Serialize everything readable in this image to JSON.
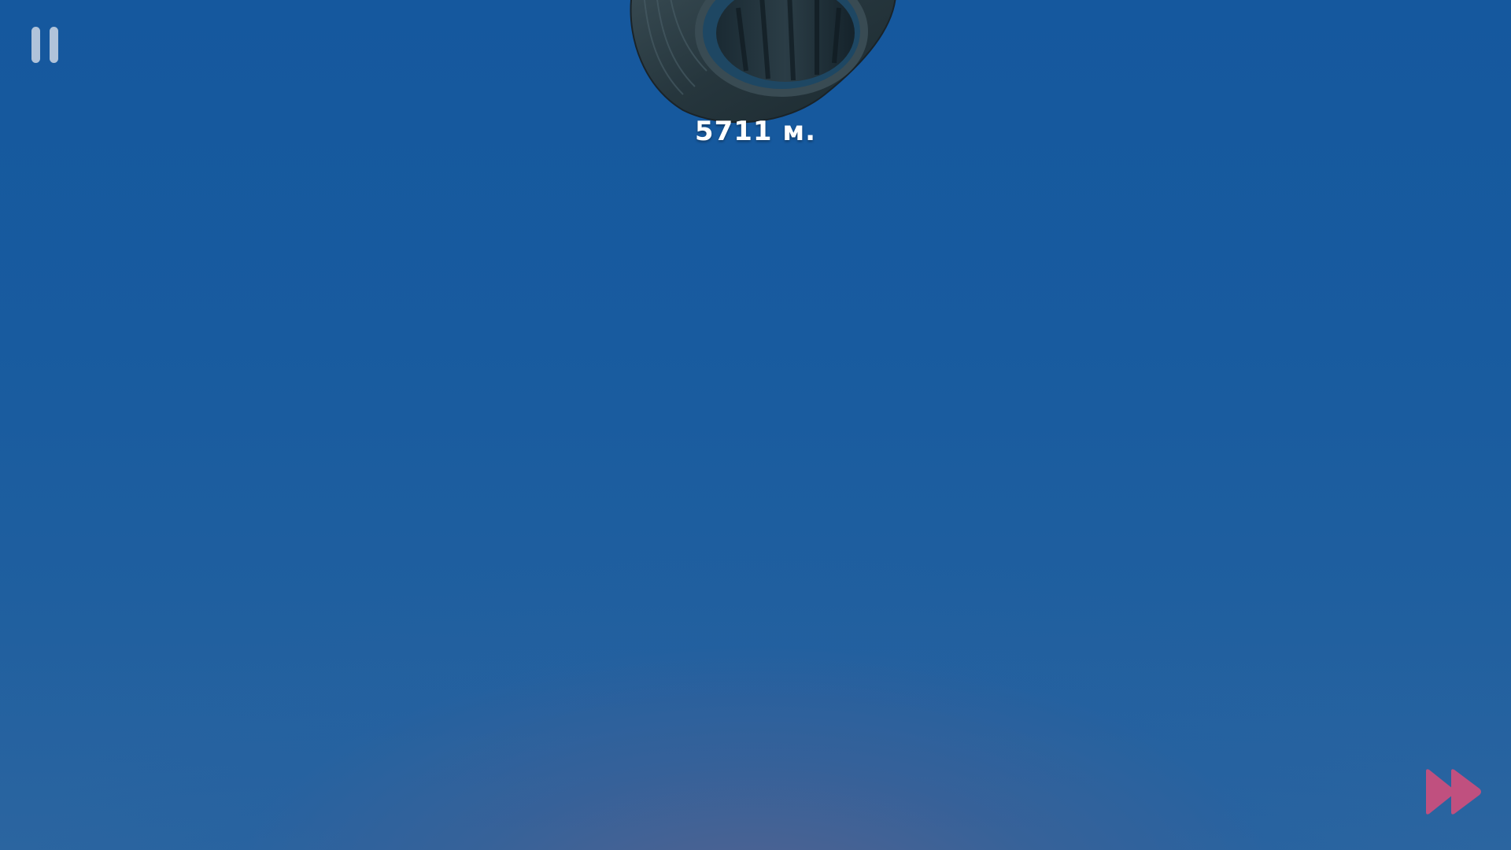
{
  "hud": {
    "distance_text": "5711 м.",
    "pause_icon": "pause-icon",
    "fast_forward_icon": "fast-forward-icon"
  },
  "scene": {
    "object_icon": "tire-icon"
  },
  "colors": {
    "sky_top": "#15589e",
    "sky_bottom_glow": "#58628e",
    "pause_button": "#dce1eb",
    "fast_forward": "#c0507f",
    "text": "#ffffff"
  }
}
